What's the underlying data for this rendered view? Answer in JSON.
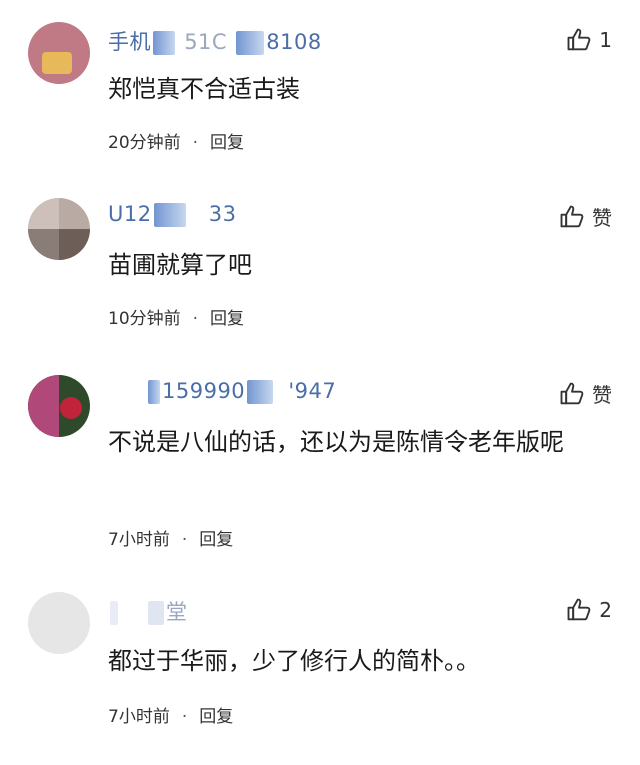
{
  "comments": [
    {
      "user_prefix": "手机",
      "user_mid": "51C",
      "user_suffix": "8108",
      "text": "郑恺真不合适古装",
      "time": "20分钟前",
      "dot": "·",
      "reply": "回复",
      "like_label": "1",
      "avatar_colors": [
        "#c07a85",
        "#e7b95a"
      ]
    },
    {
      "user_prefix": "U12",
      "user_mid": "",
      "user_suffix": "33",
      "text": "苗圃就算了吧",
      "time": "10分钟前",
      "dot": "·",
      "reply": "回复",
      "like_label": "赞",
      "avatar_colors": [
        "#a89a95",
        "#6e5e58"
      ]
    },
    {
      "user_prefix": "",
      "user_mid": "159990",
      "user_suffix": "'947",
      "text": "不说是八仙的话，还以为是陈情令老年版呢",
      "time": "7小时前",
      "dot": "·",
      "reply": "回复",
      "like_label": "赞",
      "avatar_colors": [
        "#b0487a",
        "#2f4a2a"
      ]
    },
    {
      "user_prefix": "",
      "user_mid": "",
      "user_suffix": "堂",
      "text": "都过于华丽，少了修行人的简朴。。",
      "time": "7小时前",
      "dot": "·",
      "reply": "回复",
      "like_label": "2",
      "avatar_colors": [
        "#e6e6e6",
        "#e6e6e6"
      ]
    }
  ]
}
